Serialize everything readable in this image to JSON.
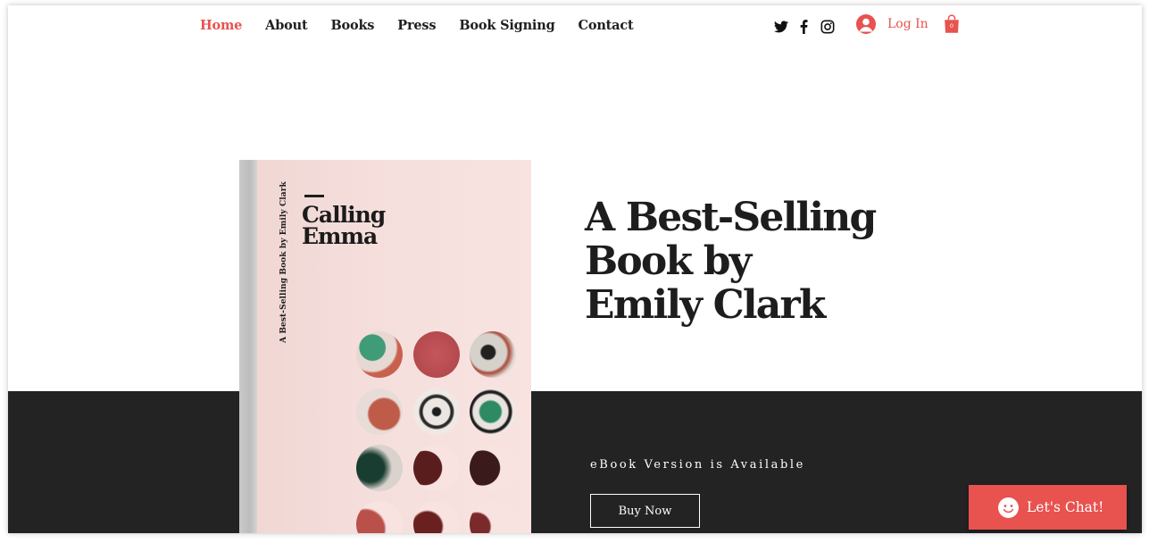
{
  "nav": {
    "items": [
      {
        "label": "Home",
        "active": true
      },
      {
        "label": "About",
        "active": false
      },
      {
        "label": "Books",
        "active": false
      },
      {
        "label": "Press",
        "active": false
      },
      {
        "label": "Book Signing",
        "active": false
      },
      {
        "label": "Contact",
        "active": false
      }
    ]
  },
  "social": {
    "icons": [
      "twitter-icon",
      "facebook-icon",
      "instagram-icon"
    ]
  },
  "account": {
    "login_label": "Log In"
  },
  "cart": {
    "count": "0"
  },
  "book": {
    "spine_text": "A Best-Selling Book by Emily Clark",
    "title_line1": "Calling",
    "title_line2": "Emma"
  },
  "hero": {
    "line1": "A Best-Selling",
    "line2": "Book by",
    "line3": "Emily Clark"
  },
  "ebook_note": "eBook Version is Available",
  "buy_label": "Buy Now",
  "chat": {
    "label": "Let's Chat!"
  },
  "colors": {
    "accent": "#e8524f",
    "dark_band": "#232323",
    "text": "#1d1d1d",
    "cover": "#f6e0de"
  }
}
